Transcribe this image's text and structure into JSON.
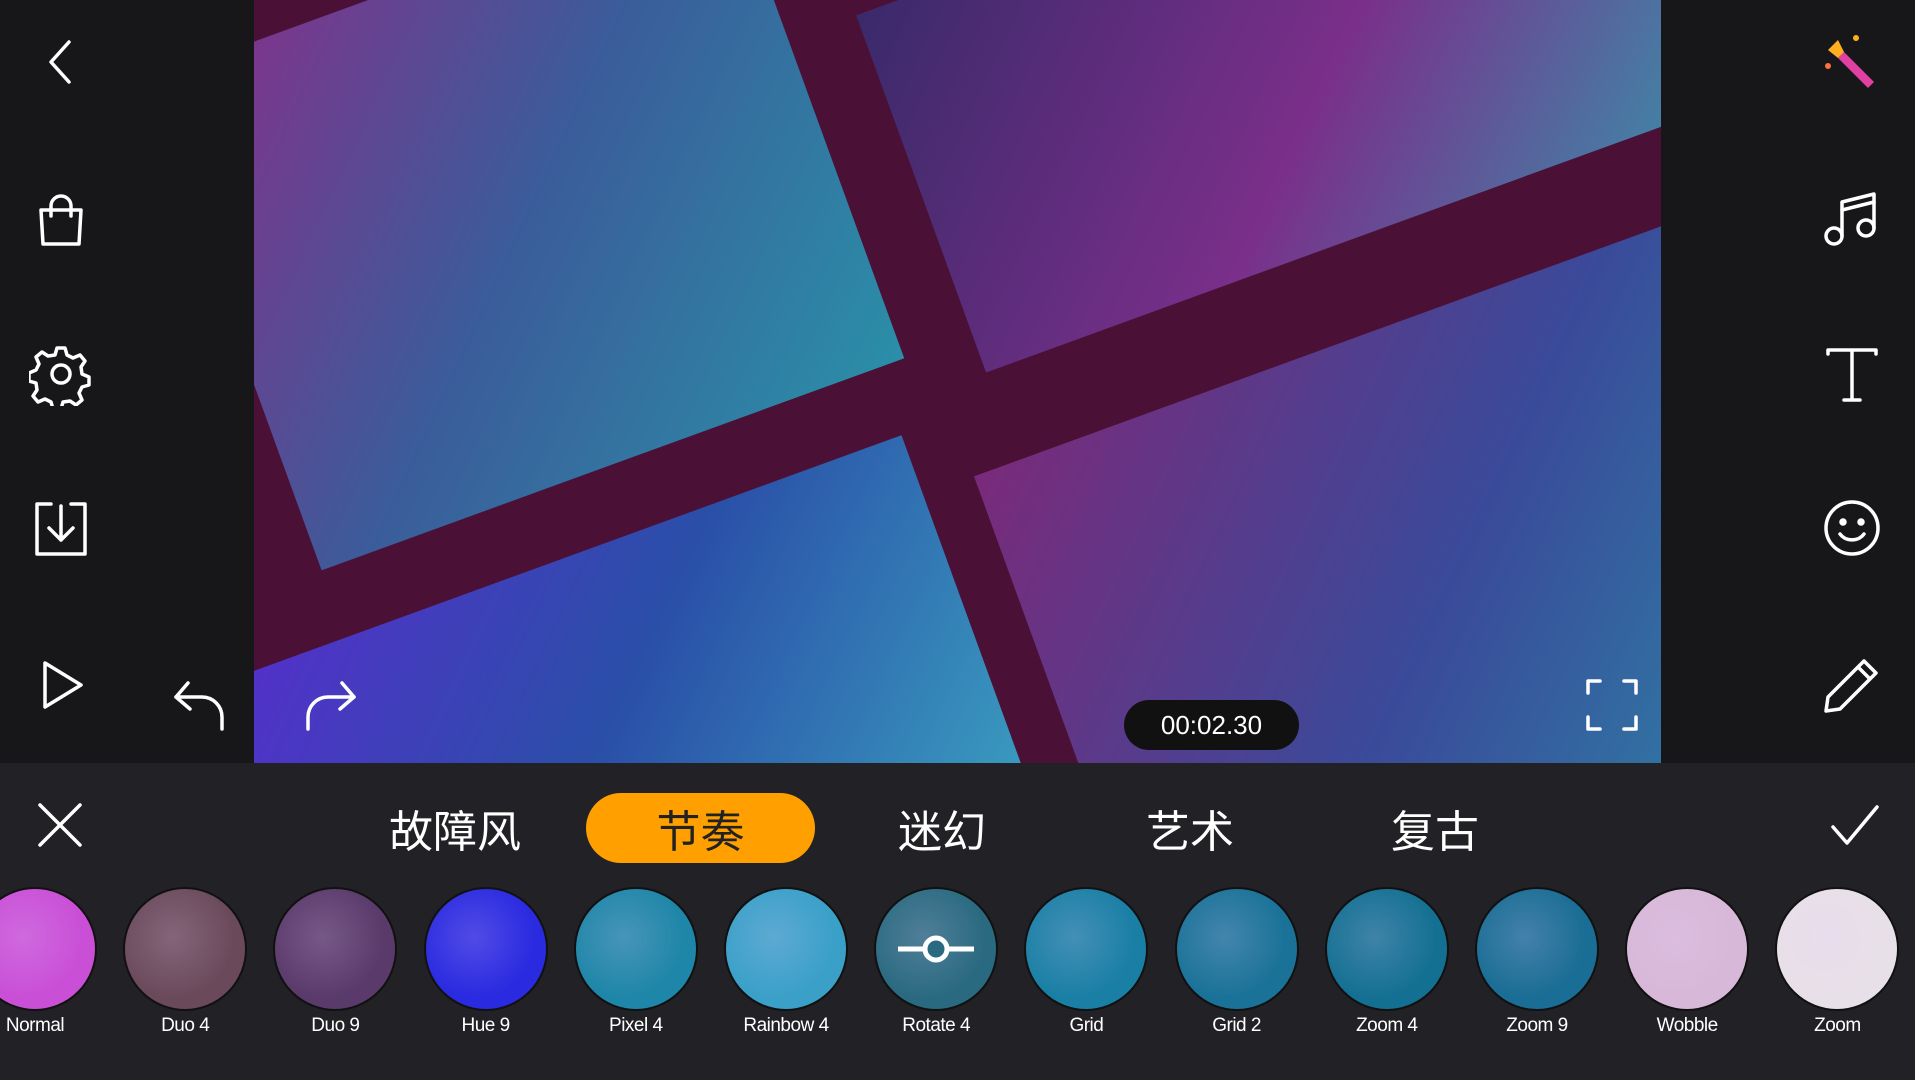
{
  "left_toolbar": {
    "icons": [
      "back-icon",
      "shopping-bag-icon",
      "gear-icon",
      "download-icon",
      "play-icon"
    ]
  },
  "right_toolbar": {
    "icons": [
      "magic-wand-icon",
      "music-icon",
      "text-icon",
      "sticker-smiley-icon",
      "pencil-icon"
    ]
  },
  "player": {
    "timestamp": "00:02.30",
    "undo": "undo-icon",
    "redo": "redo-icon",
    "fullscreen": "fullscreen-icon"
  },
  "effects_panel": {
    "tabs": [
      {
        "label": "故障风"
      },
      {
        "label": "节奏",
        "active": true
      },
      {
        "label": "迷幻"
      },
      {
        "label": "艺术"
      },
      {
        "label": "复古"
      }
    ],
    "accent_color": "#ffa000",
    "effects": [
      {
        "label": "Normal",
        "color": "#c94fd6"
      },
      {
        "label": "Duo 4",
        "color": "#6a4a5a"
      },
      {
        "label": "Duo 9",
        "color": "#5a3a6a"
      },
      {
        "label": "Hue 9",
        "color": "#2a2ae0"
      },
      {
        "label": "Pixel 4",
        "color": "#1e86a8"
      },
      {
        "label": "Rainbow 4",
        "color": "#3aa0c8"
      },
      {
        "label": "Rotate 4",
        "color": "#2a6a80"
      },
      {
        "label": "Grid",
        "color": "#1a7fa5"
      },
      {
        "label": "Grid 2",
        "color": "#1a7298"
      },
      {
        "label": "Zoom 4",
        "color": "#147092"
      },
      {
        "label": "Zoom 9",
        "color": "#1a6d95"
      },
      {
        "label": "Wobble",
        "color": "#d8b8d8"
      },
      {
        "label": "Zoom",
        "color": "#e8e0e8"
      }
    ]
  }
}
